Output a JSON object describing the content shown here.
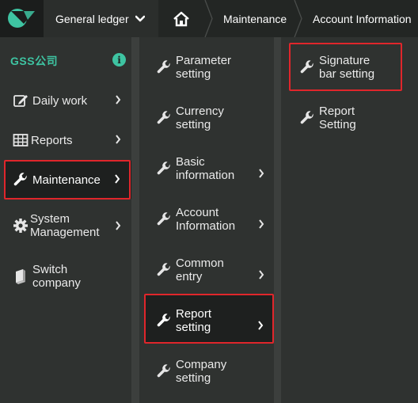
{
  "topbar": {
    "ledger_label": "General ledger",
    "breadcrumb_1": "Maintenance",
    "breadcrumb_2": "Account Information"
  },
  "sidebar": {
    "company": "GSS公司",
    "items": [
      {
        "label": "Daily work",
        "icon": "edit-icon"
      },
      {
        "label": "Reports",
        "icon": "table-icon"
      },
      {
        "label": "Maintenance",
        "icon": "wrench-icon"
      },
      {
        "label": "System Management",
        "line1": "System",
        "line2": "Management",
        "icon": "gear-icon"
      },
      {
        "label": "Switch company",
        "line1": "Switch",
        "line2": "company",
        "icon": "book-icon"
      }
    ]
  },
  "submenu": {
    "items": [
      {
        "line1": "Parameter",
        "line2": "setting"
      },
      {
        "line1": "Currency",
        "line2": "setting"
      },
      {
        "line1": "Basic",
        "line2": "information"
      },
      {
        "line1": "Account",
        "line2": "Information"
      },
      {
        "line1": "Common",
        "line2": "entry"
      },
      {
        "line1": "Report",
        "line2": "setting"
      },
      {
        "line1": "Company",
        "line2": "setting"
      }
    ]
  },
  "report_menu": {
    "items": [
      {
        "line1": "Signature",
        "line2": "bar setting"
      },
      {
        "line1": "Report",
        "line2": "Setting"
      }
    ]
  },
  "colors": {
    "accent": "#3ec4a2",
    "highlight_border": "#e0262b",
    "background": "#2f3230",
    "topbar": "#232624"
  }
}
